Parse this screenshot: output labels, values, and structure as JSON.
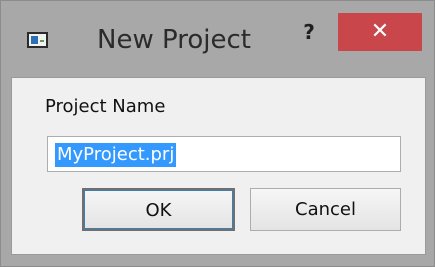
{
  "window": {
    "title": "New Project",
    "help_label": "?",
    "close_label": "✕"
  },
  "form": {
    "label": "Project Name",
    "project_name_value": "MyProject.prj"
  },
  "buttons": {
    "ok_label": "OK",
    "cancel_label": "Cancel"
  },
  "colors": {
    "close_button_bg": "#c9474a",
    "selection_bg": "#3399ff",
    "frame": "#a8a8a8"
  },
  "icons": {
    "app": "app-window-icon",
    "help": "help-icon",
    "close": "close-icon"
  }
}
